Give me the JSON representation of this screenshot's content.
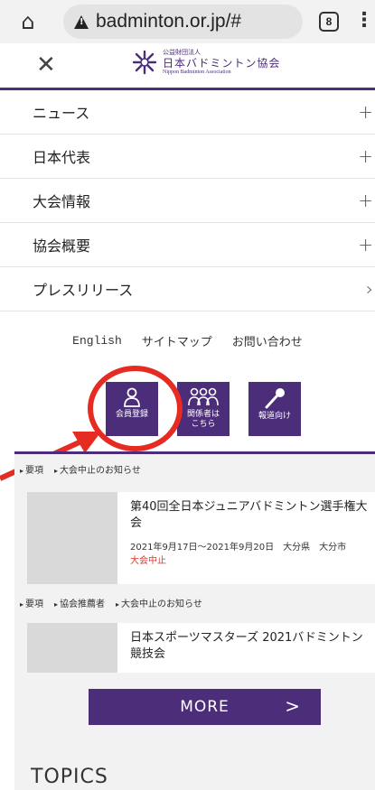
{
  "browser": {
    "url": "badminton.or.jp/#",
    "tab_count": "8"
  },
  "header": {
    "logo_sub": "公益財団法人",
    "logo_main": "日本バドミントン協会",
    "logo_en": "Nippon Badminton Association"
  },
  "nav": {
    "items": [
      {
        "label": "ニュース"
      },
      {
        "label": "日本代表"
      },
      {
        "label": "大会情報"
      },
      {
        "label": "協会概要"
      },
      {
        "label": "プレスリリース"
      }
    ],
    "expand_symbol": "+",
    "chevron_symbol": "›"
  },
  "sub_links": {
    "english": "English",
    "sitemap": "サイトマップ",
    "contact": "お問い合わせ"
  },
  "icon_buttons": {
    "member": "会員登録",
    "related_1": "関係者は",
    "related_2": "こちら",
    "press": "報道向け"
  },
  "content": {
    "tags_top": [
      "要項",
      "大会中止のお知らせ"
    ],
    "card1": {
      "title": "第40回全日本ジュニアバドミントン選手権大会",
      "date": "2021年9月17日～2021年9月20日　大分県　大分市",
      "status": "大会中止"
    },
    "tags_mid": [
      "要項",
      "協会推薦者",
      "大会中止のお知らせ"
    ],
    "card2": {
      "title": "日本スポーツマスターズ 2021バドミントン競技会"
    },
    "more_label": "MORE",
    "more_arrow": ">",
    "topics": "TOPICS"
  },
  "colors": {
    "brand": "#4b2d7a",
    "annotation": "#e52b22",
    "status_red": "#d93a2b"
  }
}
